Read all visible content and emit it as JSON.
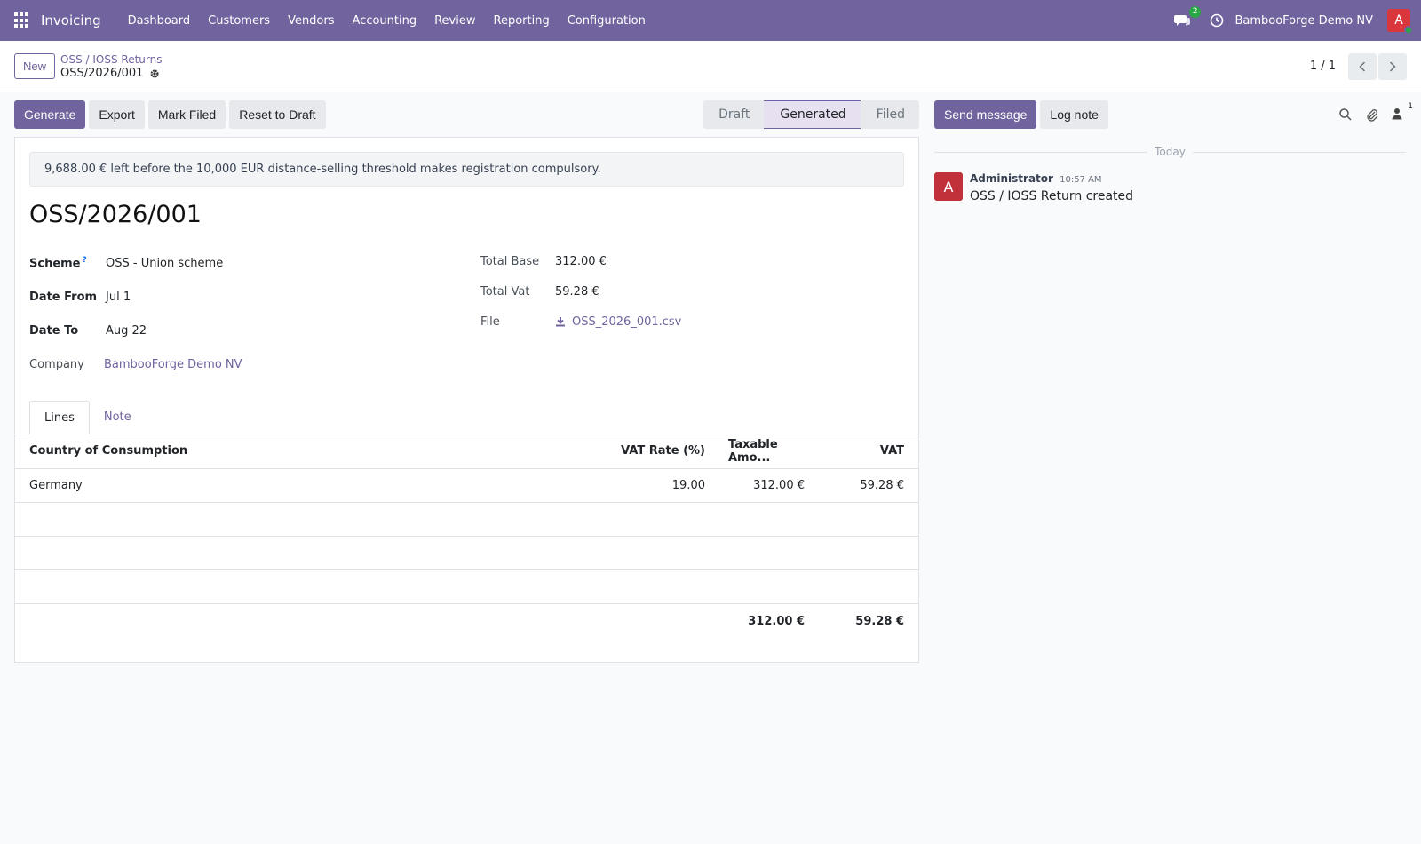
{
  "navbar": {
    "app_name": "Invoicing",
    "menu": [
      "Dashboard",
      "Customers",
      "Vendors",
      "Accounting",
      "Review",
      "Reporting",
      "Configuration"
    ],
    "chat_badge": "2",
    "company": "BambooForge Demo NV",
    "user_initial": "A"
  },
  "control_panel": {
    "new_label": "New",
    "breadcrumb_parent": "OSS / IOSS Returns",
    "record_name": "OSS/2026/001",
    "pager": "1 / 1"
  },
  "actions": {
    "generate": "Generate",
    "export": "Export",
    "mark_filed": "Mark Filed",
    "reset_to_draft": "Reset to Draft"
  },
  "stages": {
    "draft": "Draft",
    "generated": "Generated",
    "filed": "Filed",
    "current": "Generated"
  },
  "form": {
    "alert": "9,688.00 € left before the 10,000 EUR distance-selling threshold makes registration compulsory.",
    "title": "OSS/2026/001",
    "scheme_label": "Scheme",
    "scheme_help": "?",
    "scheme_value": "OSS - Union scheme",
    "date_from_label": "Date From",
    "date_from_value": "Jul 1",
    "date_to_label": "Date To",
    "date_to_value": "Aug 22",
    "company_label": "Company",
    "company_value": "BambooForge Demo NV",
    "total_base_label": "Total Base",
    "total_base_value": "312.00 €",
    "total_vat_label": "Total Vat",
    "total_vat_value": "59.28 €",
    "file_label": "File",
    "file_value": "OSS_2026_001.csv"
  },
  "tabs": {
    "lines": "Lines",
    "note": "Note",
    "active": "Lines"
  },
  "lines_table": {
    "headers": [
      "Country of Consumption",
      "VAT Rate (%)",
      "Taxable Amo...",
      "VAT"
    ],
    "rows": [
      {
        "country": "Germany",
        "rate": "19.00",
        "taxable": "312.00 €",
        "vat": "59.28 €"
      }
    ],
    "totals": {
      "taxable": "312.00 €",
      "vat": "59.28 €"
    }
  },
  "chatter": {
    "send_message": "Send message",
    "log_note": "Log note",
    "followers_count": "1",
    "date_separator": "Today",
    "messages": [
      {
        "avatar": "A",
        "author": "Administrator",
        "time": "10:57 AM",
        "body": "OSS / IOSS Return created"
      }
    ]
  },
  "colors": {
    "brand": "#71639e",
    "avatar_red": "#d9363e",
    "online_green": "#28a745"
  }
}
